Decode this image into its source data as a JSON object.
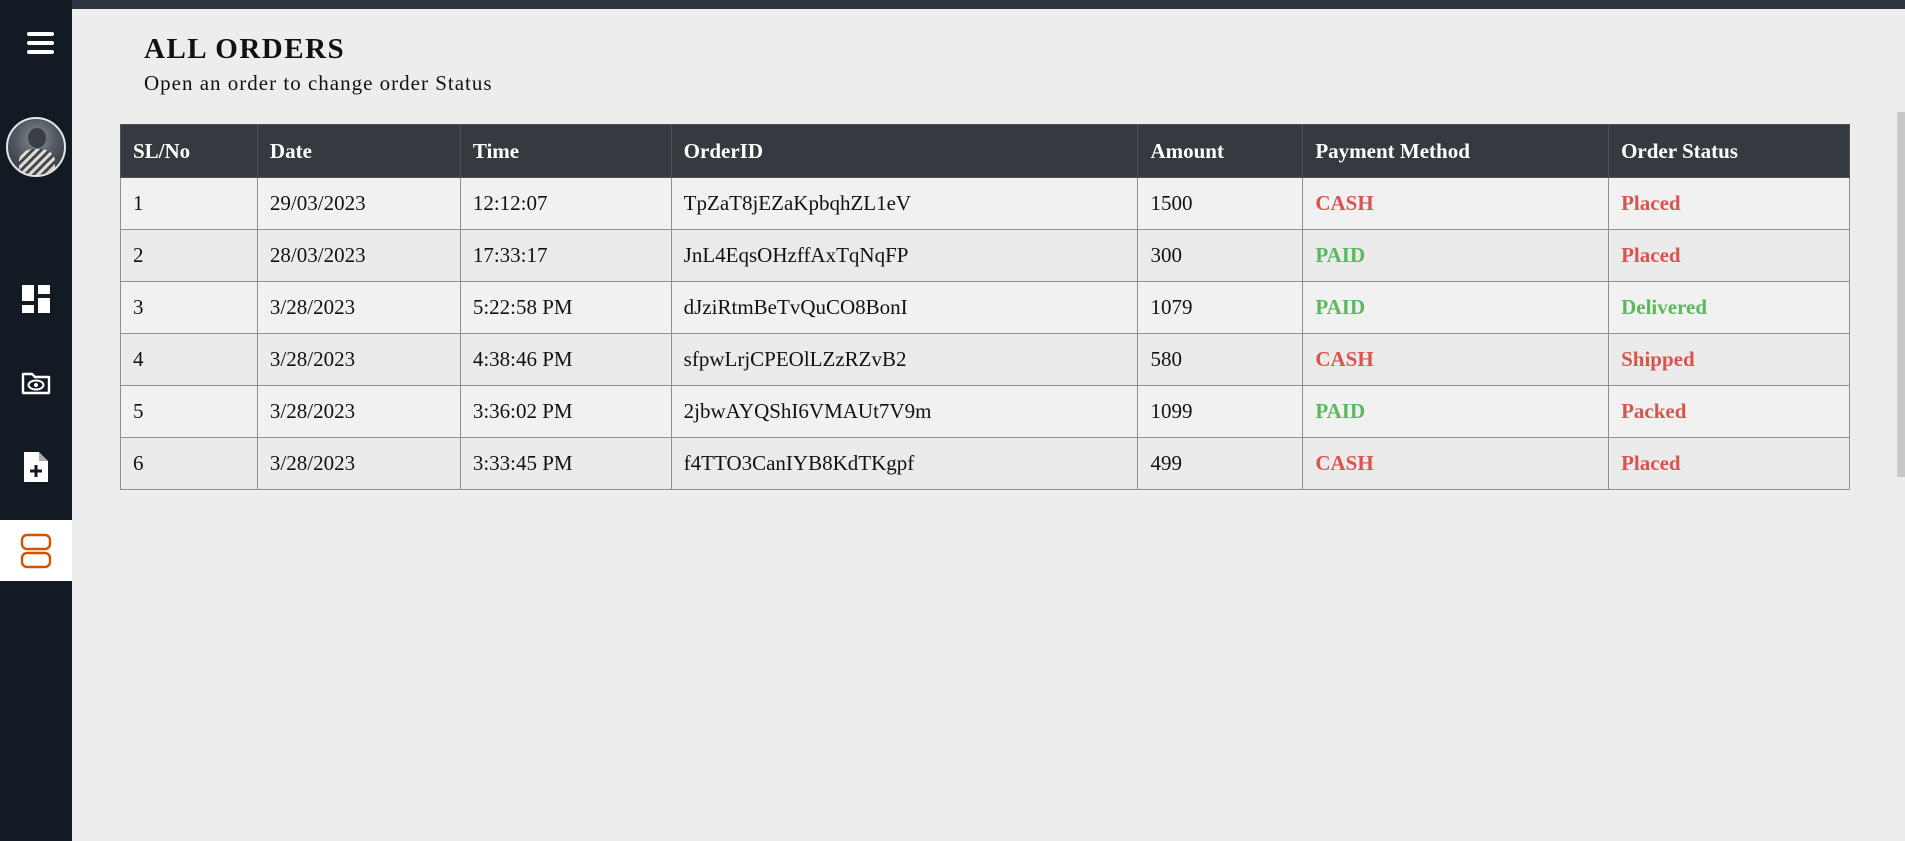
{
  "header": {
    "title": "ALL ORDERS",
    "subtitle": "Open an order to change order Status"
  },
  "sidebar": {
    "items": [
      {
        "icon": "menu-icon"
      },
      {
        "icon": "avatar"
      },
      {
        "icon": "dashboard-icon"
      },
      {
        "icon": "folder-eye-icon"
      },
      {
        "icon": "file-add-icon"
      },
      {
        "icon": "orders-icon",
        "active": true
      }
    ]
  },
  "table": {
    "columns": [
      "SL/No",
      "Date",
      "Time",
      "OrderID",
      "Amount",
      "Payment Method",
      "Order Status"
    ],
    "rows": [
      {
        "sl": "1",
        "date": "29/03/2023",
        "time": "12:12:07",
        "order_id": "TpZaT8jEZaKpbqhZL1eV",
        "amount": "1500",
        "payment": "CASH",
        "status": "Placed"
      },
      {
        "sl": "2",
        "date": "28/03/2023",
        "time": "17:33:17",
        "order_id": "JnL4EqsOHzffAxTqNqFP",
        "amount": "300",
        "payment": "PAID",
        "status": "Placed"
      },
      {
        "sl": "3",
        "date": "3/28/2023",
        "time": "5:22:58 PM",
        "order_id": "dJziRtmBeTvQuCO8BonI",
        "amount": "1079",
        "payment": "PAID",
        "status": "Delivered"
      },
      {
        "sl": "4",
        "date": "3/28/2023",
        "time": "4:38:46 PM",
        "order_id": "sfpwLrjCPEOlLZzRZvB2",
        "amount": "580",
        "payment": "CASH",
        "status": "Shipped"
      },
      {
        "sl": "5",
        "date": "3/28/2023",
        "time": "3:36:02 PM",
        "order_id": "2jbwAYQShI6VMAUt7V9m",
        "amount": "1099",
        "payment": "PAID",
        "status": "Packed"
      },
      {
        "sl": "6",
        "date": "3/28/2023",
        "time": "3:33:45 PM",
        "order_id": "f4TTO3CanIYB8KdTKgpf",
        "amount": "499",
        "payment": "CASH",
        "status": "Placed"
      }
    ]
  },
  "colors": {
    "sidebar": "#121a23",
    "table_header": "#343a40",
    "status_red": "#d9534f",
    "status_green": "#5cb85c",
    "active_icon": "#d35400"
  }
}
